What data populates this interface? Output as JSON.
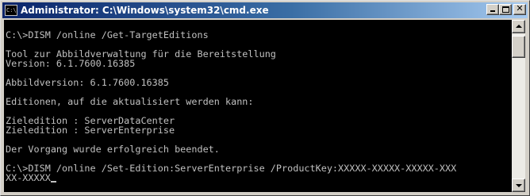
{
  "window": {
    "title": "Administrator: C:\\Windows\\system32\\cmd.exe",
    "icon_text": "C:\\",
    "icon": "cmd-icon",
    "controls": {
      "minimize": "minimize-icon",
      "maximize": "maximize-icon",
      "close": "close-icon",
      "close_glyph": "✕"
    }
  },
  "console": {
    "lines": [
      "C:\\>DISM /online /Get-TargetEditions",
      "",
      "Tool zur Abbildverwaltung für die Bereitstellung",
      "Version: 6.1.7600.16385",
      "",
      "Abbildversion: 6.1.7600.16385",
      "",
      "Editionen, auf die aktualisiert werden kann:",
      "",
      "Zieledition : ServerDataCenter",
      "Zieledition : ServerEnterprise",
      "",
      "Der Vorgang wurde erfolgreich beendet.",
      "",
      "C:\\>DISM /online /Set-Edition:ServerEnterprise /ProductKey:XXXXX-XXXXX-XXXXX-XXX",
      "XX-XXXXX"
    ],
    "text_color": "#c0c0c0",
    "background": "#000000"
  },
  "scrollbar": {
    "up": "scroll-up-arrow-icon",
    "down": "scroll-down-arrow-icon"
  }
}
